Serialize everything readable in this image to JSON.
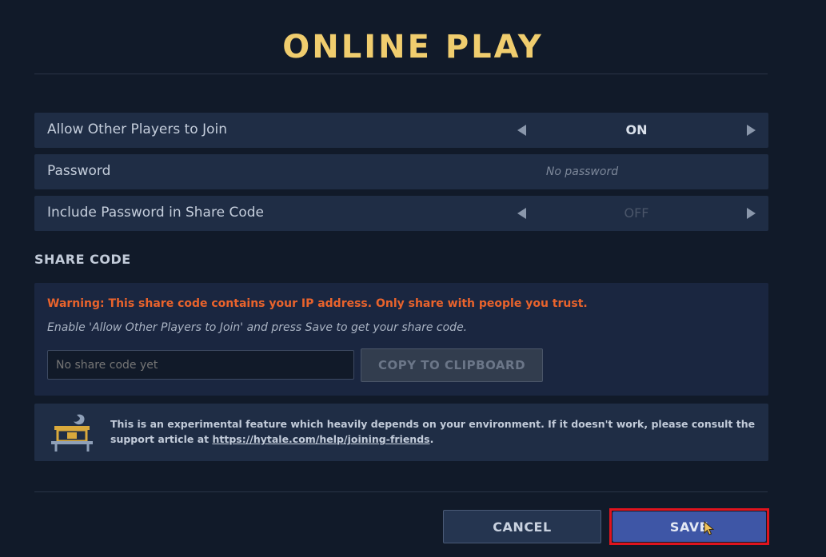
{
  "title": "ONLINE PLAY",
  "settings": [
    {
      "label": "Allow Other Players to Join",
      "value": "ON"
    },
    {
      "label": "Password",
      "placeholder": "No password"
    },
    {
      "label": "Include Password in Share Code",
      "value": "OFF"
    }
  ],
  "share_code": {
    "section_title": "SHARE CODE",
    "warning": "Warning: This share code contains your IP address. Only share with people you trust.",
    "hint": "Enable 'Allow Other Players to Join' and press Save to get your share code.",
    "code_placeholder": "No share code yet",
    "copy_label": "COPY TO CLIPBOARD"
  },
  "info": {
    "icon": "experimental-workbench-icon",
    "text_prefix": "This is an experimental feature which heavily depends on your environment. If it doesn't work, please consult the support article at ",
    "link": "https://hytale.com/help/joining-friends",
    "text_suffix": "."
  },
  "buttons": {
    "cancel": "CANCEL",
    "save": "SAVE"
  },
  "colors": {
    "title": "#f0cd6e",
    "warning": "#e9632c",
    "save_bg": "#3e56a6",
    "highlight": "#e0141e"
  }
}
